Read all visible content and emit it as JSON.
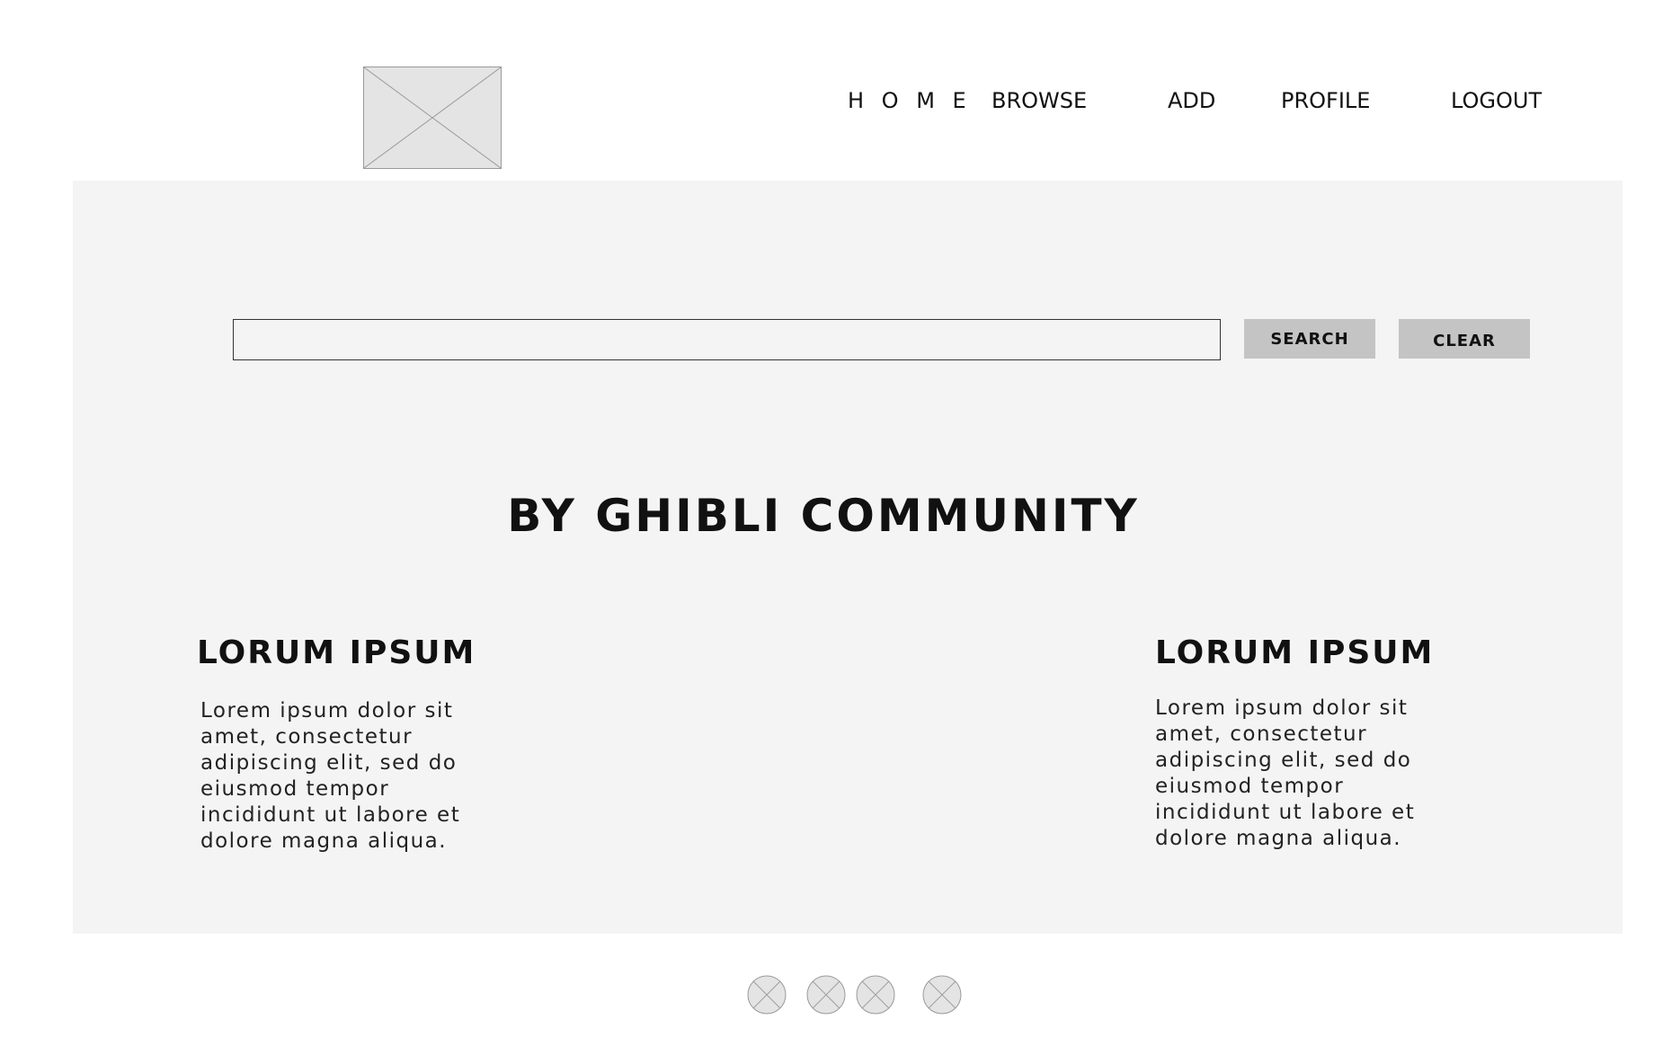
{
  "header": {
    "logo_icon": "image-placeholder-icon",
    "nav": {
      "home": "H O M E",
      "browse": "BROWSE",
      "add": "ADD",
      "profile": "PROFILE",
      "logout": "LOGOUT"
    }
  },
  "search": {
    "value": "",
    "placeholder": "",
    "search_label": "SEARCH",
    "clear_label": "CLEAR"
  },
  "main": {
    "headline": "BY GHIBLI COMMUNITY",
    "columns": [
      {
        "title": "LORUM IPSUM",
        "text": "Lorem ipsum dolor sit amet, consectetur adipiscing elit, sed do eiusmod tempor incididunt ut labore et dolore magna aliqua."
      },
      {
        "title": "LORUM IPSUM",
        "text": "Lorem ipsum dolor sit amet, consectetur adipiscing elit, sed do eiusmod tempor incididunt ut labore et dolore magna aliqua."
      }
    ]
  },
  "footer": {
    "social_icons": [
      "social-placeholder-icon",
      "social-placeholder-icon",
      "social-placeholder-icon",
      "social-placeholder-icon"
    ]
  },
  "colors": {
    "panel_background": "#f4f4f4",
    "button_background": "#c4c4c4",
    "placeholder_fill": "#e4e4e4",
    "placeholder_stroke": "#9a9a9a",
    "text": "#111111"
  }
}
